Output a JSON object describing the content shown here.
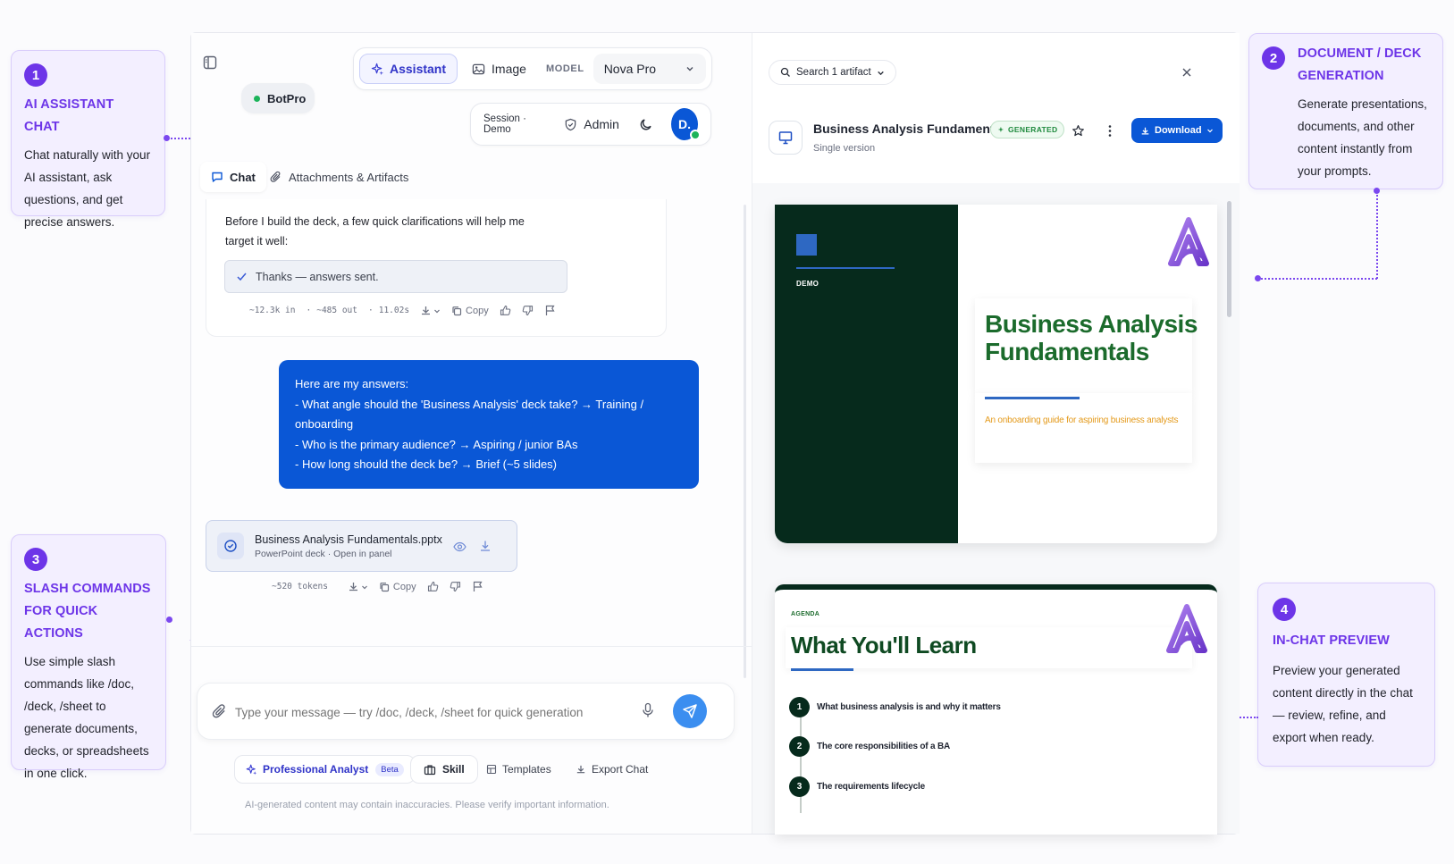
{
  "callouts": [
    {
      "num": "1",
      "title": "AI ASSISTANT CHAT",
      "body": "Chat naturally with your AI assistant, ask questions, and get precise answers."
    },
    {
      "num": "2",
      "title": "DOCUMENT / DECK GENERATION",
      "body": "Generate presentations, documents, and other content instantly from your prompts."
    },
    {
      "num": "3",
      "title": "SLASH COMMANDS FOR QUICK ACTIONS",
      "body": "Use simple slash commands like /doc, /deck, /sheet to generate documents, decks, or spreadsheets in one click."
    },
    {
      "num": "4",
      "title": "IN-CHAT PREVIEW",
      "body": "Preview your generated content directly in the chat — review, refine, and export when ready."
    }
  ],
  "header": {
    "brand": "BotPro",
    "mode_assistant": "Assistant",
    "mode_image": "Image",
    "model_label": "MODEL",
    "model_value": "Nova Pro",
    "session": "Session · Demo",
    "admin": "Admin",
    "avatar": "D."
  },
  "tabs": {
    "chat": "Chat",
    "attachments": "Attachments & Artifacts"
  },
  "messages": {
    "assistant_1": {
      "text_line1": "Before I build the deck, a few quick clarifications will help me",
      "text_line2": "target it well:",
      "confirm": "Thanks — answers sent.",
      "stats_in": "~12.3k in",
      "stats_out": "~485 out",
      "stats_time": "11.02s",
      "copy": "Copy"
    },
    "user_1": {
      "lines": [
        "Here are my answers:",
        "- What angle should the 'Business Analysis' deck take? → Training /",
        "onboarding",
        "- Who is the primary audience? → Aspiring / junior BAs",
        "- How long should the deck be? → Brief (~5 slides)"
      ]
    },
    "assistant_2": {
      "file_name": "Business Analysis Fundamentals.pptx",
      "file_meta": "PowerPoint deck · Open in panel",
      "tokens": "~520 tokens",
      "copy": "Copy"
    }
  },
  "composer": {
    "placeholder": "Type your message — try /doc, /deck, /sheet for quick generation",
    "persona": "Professional Analyst",
    "persona_badge": "Beta",
    "skill": "Skill",
    "templates": "Templates",
    "export": "Export Chat",
    "disclaimer": "AI-generated content may contain inaccuracies. Please verify important information."
  },
  "artifact_panel": {
    "search": "Search 1 artifact",
    "title": "Business Analysis Fundamentals",
    "badge": "GENERATED",
    "version": "Single version",
    "download": "Download"
  },
  "slide1": {
    "tag": "DEMO",
    "title_line1": "Business Analysis",
    "title_line2": "Fundamentals",
    "subtitle": "An onboarding guide for aspiring business analysts"
  },
  "slide2": {
    "tag": "AGENDA",
    "title": "What You'll Learn",
    "items": [
      {
        "n": "1",
        "text": "What business analysis is and why it matters"
      },
      {
        "n": "2",
        "text": "The core responsibilities of a BA"
      },
      {
        "n": "3",
        "text": "The requirements lifecycle"
      }
    ]
  },
  "colors": {
    "accent": "#6d35e8",
    "primary_blue": "#0a57d6",
    "slide_dark": "#062a1c",
    "slide_green": "#1b6b2c",
    "slide_orange": "#e49a1b"
  }
}
